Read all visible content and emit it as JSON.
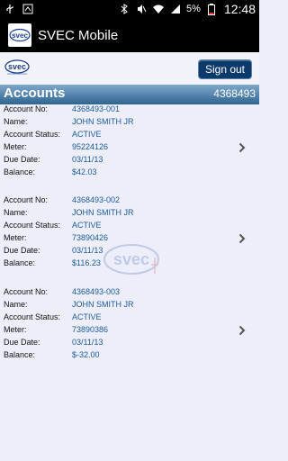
{
  "status_bar": {
    "battery_pct": "5%",
    "time": "12:48"
  },
  "app": {
    "title": "SVEC Mobile",
    "logo_text": "svec"
  },
  "header": {
    "logo_text": "svec",
    "signout_label": "Sign out"
  },
  "section": {
    "title": "Accounts",
    "member_no": "4368493"
  },
  "labels": {
    "account_no": "Account No:",
    "name": "Name:",
    "status": "Account Status:",
    "meter": "Meter:",
    "due_date": "Due Date:",
    "balance": "Balance:"
  },
  "accounts": [
    {
      "account_no": "4368493-001",
      "name": "JOHN SMITH JR",
      "status": "ACTIVE",
      "meter": "95224126",
      "due_date": "03/11/13",
      "balance": "$42.03"
    },
    {
      "account_no": "4368493-002",
      "name": "JOHN SMITH JR",
      "status": "ACTIVE",
      "meter": "73890426",
      "due_date": "03/11/13",
      "balance": "$116.23"
    },
    {
      "account_no": "4368493-003",
      "name": "JOHN SMITH JR",
      "status": "ACTIVE",
      "meter": "73890386",
      "due_date": "03/11/13",
      "balance": "$-32.00"
    }
  ],
  "watermark": {
    "text": "svec"
  },
  "colors": {
    "accent": "#0c3a6a",
    "section_bar": "#4a7aa3",
    "value_text": "#1a5a9a",
    "page_bg": "#eeeefa"
  }
}
